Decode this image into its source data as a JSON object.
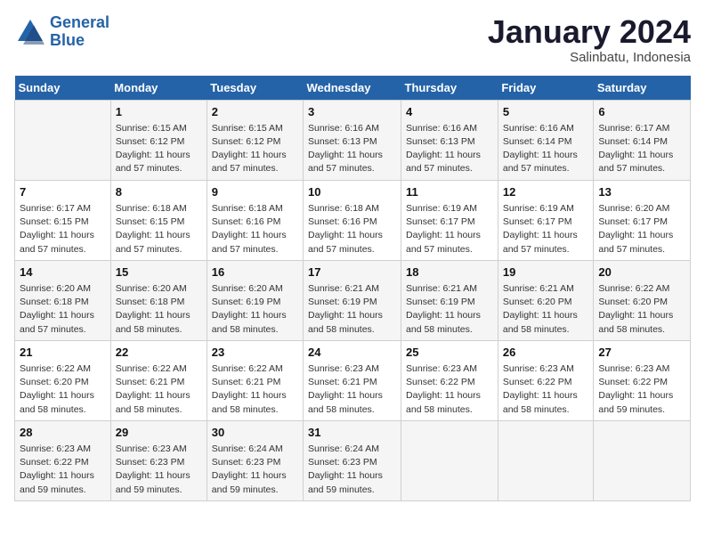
{
  "logo": {
    "text_general": "General",
    "text_blue": "Blue"
  },
  "header": {
    "month": "January 2024",
    "location": "Salinbatu, Indonesia"
  },
  "weekdays": [
    "Sunday",
    "Monday",
    "Tuesday",
    "Wednesday",
    "Thursday",
    "Friday",
    "Saturday"
  ],
  "weeks": [
    [
      {
        "day": "",
        "info": ""
      },
      {
        "day": "1",
        "info": "Sunrise: 6:15 AM\nSunset: 6:12 PM\nDaylight: 11 hours\nand 57 minutes."
      },
      {
        "day": "2",
        "info": "Sunrise: 6:15 AM\nSunset: 6:12 PM\nDaylight: 11 hours\nand 57 minutes."
      },
      {
        "day": "3",
        "info": "Sunrise: 6:16 AM\nSunset: 6:13 PM\nDaylight: 11 hours\nand 57 minutes."
      },
      {
        "day": "4",
        "info": "Sunrise: 6:16 AM\nSunset: 6:13 PM\nDaylight: 11 hours\nand 57 minutes."
      },
      {
        "day": "5",
        "info": "Sunrise: 6:16 AM\nSunset: 6:14 PM\nDaylight: 11 hours\nand 57 minutes."
      },
      {
        "day": "6",
        "info": "Sunrise: 6:17 AM\nSunset: 6:14 PM\nDaylight: 11 hours\nand 57 minutes."
      }
    ],
    [
      {
        "day": "7",
        "info": "Sunrise: 6:17 AM\nSunset: 6:15 PM\nDaylight: 11 hours\nand 57 minutes."
      },
      {
        "day": "8",
        "info": "Sunrise: 6:18 AM\nSunset: 6:15 PM\nDaylight: 11 hours\nand 57 minutes."
      },
      {
        "day": "9",
        "info": "Sunrise: 6:18 AM\nSunset: 6:16 PM\nDaylight: 11 hours\nand 57 minutes."
      },
      {
        "day": "10",
        "info": "Sunrise: 6:18 AM\nSunset: 6:16 PM\nDaylight: 11 hours\nand 57 minutes."
      },
      {
        "day": "11",
        "info": "Sunrise: 6:19 AM\nSunset: 6:17 PM\nDaylight: 11 hours\nand 57 minutes."
      },
      {
        "day": "12",
        "info": "Sunrise: 6:19 AM\nSunset: 6:17 PM\nDaylight: 11 hours\nand 57 minutes."
      },
      {
        "day": "13",
        "info": "Sunrise: 6:20 AM\nSunset: 6:17 PM\nDaylight: 11 hours\nand 57 minutes."
      }
    ],
    [
      {
        "day": "14",
        "info": "Sunrise: 6:20 AM\nSunset: 6:18 PM\nDaylight: 11 hours\nand 57 minutes."
      },
      {
        "day": "15",
        "info": "Sunrise: 6:20 AM\nSunset: 6:18 PM\nDaylight: 11 hours\nand 58 minutes."
      },
      {
        "day": "16",
        "info": "Sunrise: 6:20 AM\nSunset: 6:19 PM\nDaylight: 11 hours\nand 58 minutes."
      },
      {
        "day": "17",
        "info": "Sunrise: 6:21 AM\nSunset: 6:19 PM\nDaylight: 11 hours\nand 58 minutes."
      },
      {
        "day": "18",
        "info": "Sunrise: 6:21 AM\nSunset: 6:19 PM\nDaylight: 11 hours\nand 58 minutes."
      },
      {
        "day": "19",
        "info": "Sunrise: 6:21 AM\nSunset: 6:20 PM\nDaylight: 11 hours\nand 58 minutes."
      },
      {
        "day": "20",
        "info": "Sunrise: 6:22 AM\nSunset: 6:20 PM\nDaylight: 11 hours\nand 58 minutes."
      }
    ],
    [
      {
        "day": "21",
        "info": "Sunrise: 6:22 AM\nSunset: 6:20 PM\nDaylight: 11 hours\nand 58 minutes."
      },
      {
        "day": "22",
        "info": "Sunrise: 6:22 AM\nSunset: 6:21 PM\nDaylight: 11 hours\nand 58 minutes."
      },
      {
        "day": "23",
        "info": "Sunrise: 6:22 AM\nSunset: 6:21 PM\nDaylight: 11 hours\nand 58 minutes."
      },
      {
        "day": "24",
        "info": "Sunrise: 6:23 AM\nSunset: 6:21 PM\nDaylight: 11 hours\nand 58 minutes."
      },
      {
        "day": "25",
        "info": "Sunrise: 6:23 AM\nSunset: 6:22 PM\nDaylight: 11 hours\nand 58 minutes."
      },
      {
        "day": "26",
        "info": "Sunrise: 6:23 AM\nSunset: 6:22 PM\nDaylight: 11 hours\nand 58 minutes."
      },
      {
        "day": "27",
        "info": "Sunrise: 6:23 AM\nSunset: 6:22 PM\nDaylight: 11 hours\nand 59 minutes."
      }
    ],
    [
      {
        "day": "28",
        "info": "Sunrise: 6:23 AM\nSunset: 6:22 PM\nDaylight: 11 hours\nand 59 minutes."
      },
      {
        "day": "29",
        "info": "Sunrise: 6:23 AM\nSunset: 6:23 PM\nDaylight: 11 hours\nand 59 minutes."
      },
      {
        "day": "30",
        "info": "Sunrise: 6:24 AM\nSunset: 6:23 PM\nDaylight: 11 hours\nand 59 minutes."
      },
      {
        "day": "31",
        "info": "Sunrise: 6:24 AM\nSunset: 6:23 PM\nDaylight: 11 hours\nand 59 minutes."
      },
      {
        "day": "",
        "info": ""
      },
      {
        "day": "",
        "info": ""
      },
      {
        "day": "",
        "info": ""
      }
    ]
  ]
}
